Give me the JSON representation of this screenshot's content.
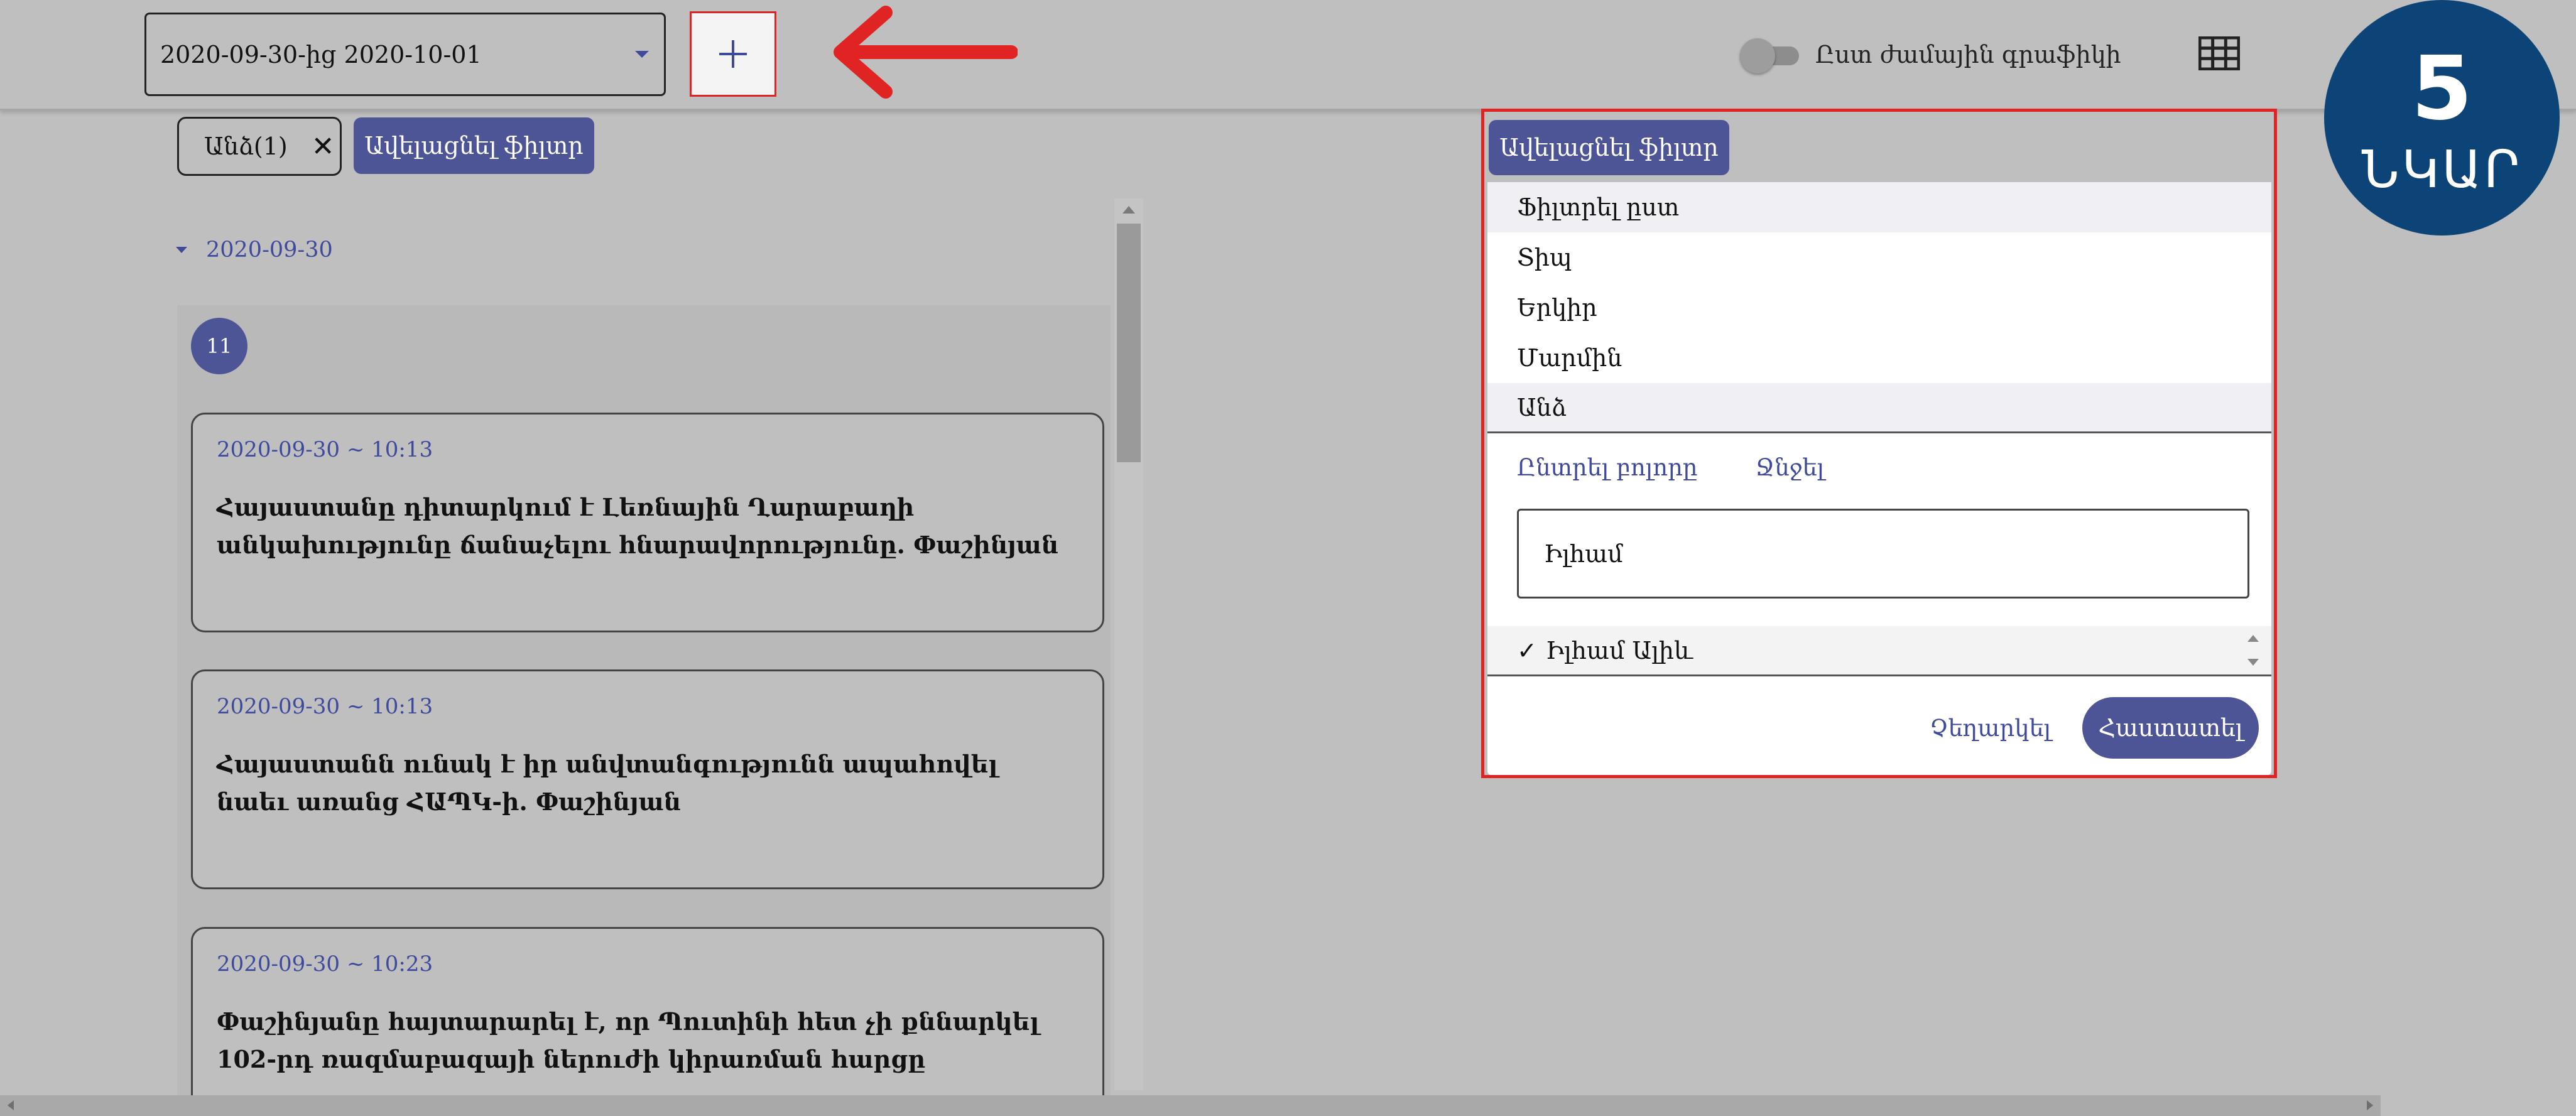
{
  "header": {
    "date_range": "2020-09-30-ից 2020-10-01",
    "add_button": "+",
    "toggle_label": "Ըստ ժամային գրաֆիկի"
  },
  "badge": {
    "number": "5",
    "word": "ՆԿԱՐ"
  },
  "filters_bar": {
    "chip_label": "Անձ(1)",
    "chip_close": "✕",
    "remove_filter": "Ավելացնել ֆիլտր"
  },
  "feed": {
    "date": "2020-09-30",
    "count": "11",
    "items": [
      {
        "time": "2020-09-30 ~ 10:13",
        "title": "Հայաստանը դիտարկում է Լեռնային Ղարաբաղի անկախությունը ճանաչելու հնարավորությունը. Փաշինյան"
      },
      {
        "time": "2020-09-30 ~ 10:13",
        "title": "Հայաստանն ունակ է իր անվտանգությունն ապահովել նաեւ առանց ՀԱՊԿ-ի. Փաշինյան"
      },
      {
        "time": "2020-09-30 ~ 10:23",
        "title": "Փաշինյանը հայտարարել է, որ Պուտինի հետ չի քննարկել 102-րդ ռազմաբազայի ներուժի կիրառման հարցը"
      }
    ]
  },
  "popup": {
    "remove_filter": "Ավելացնել ֆիլտր",
    "options": [
      "Ֆիլտրել ըստ",
      "Տիպ",
      "Երկիր",
      "Մարմին",
      "Անձ"
    ],
    "select_all": "Ընտրել բոլորը",
    "clear": "Ջնջել",
    "search_value": "Իլհամ",
    "check_mark": "✓",
    "result": "Իլհամ Ալիև",
    "cancel": "Չեղարկել",
    "confirm": "Հաստատել"
  },
  "colors": {
    "accent": "#4d5597",
    "highlight_border": "#e02424",
    "badge": "#0d4477",
    "background": "#bfbfbf"
  },
  "icons": [
    "plus-icon",
    "red-arrow-icon",
    "grid-icon",
    "close-icon",
    "caret-down-icon",
    "check-icon"
  ]
}
